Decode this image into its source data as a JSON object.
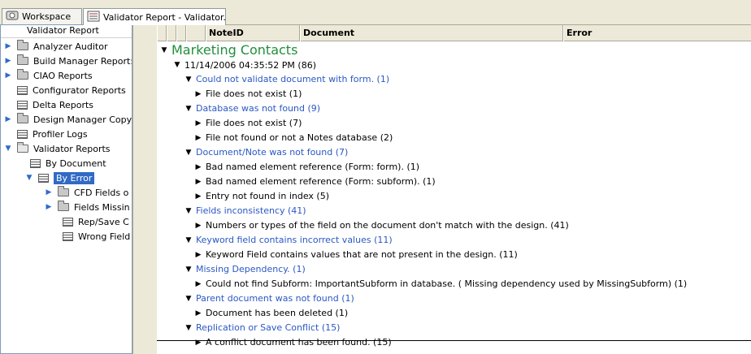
{
  "tabs": [
    {
      "label": "Workspace",
      "icon": "workspace-icon"
    },
    {
      "label": "Validator Report - Validator...",
      "icon": "validator-report-icon",
      "close": "×"
    }
  ],
  "left_panel": {
    "title": "Validator Report",
    "items": [
      {
        "label": "Analyzer Auditor",
        "type": "folder",
        "expander": "▶"
      },
      {
        "label": "Build Manager Report:",
        "type": "folder",
        "expander": "▶"
      },
      {
        "label": "CIAO Reports",
        "type": "folder",
        "expander": "▶"
      },
      {
        "label": "Configurator Reports",
        "type": "view"
      },
      {
        "label": "Delta Reports",
        "type": "view"
      },
      {
        "label": "Design Manager Copy",
        "type": "folder",
        "expander": "▶"
      },
      {
        "label": "Profiler Logs",
        "type": "view"
      },
      {
        "label": "Validator Reports",
        "type": "folder-open",
        "expander": "▼"
      },
      {
        "label": "By Document",
        "type": "view"
      },
      {
        "label": "By Error",
        "type": "view-selected",
        "expander": "▼"
      },
      {
        "label": "CFD Fields o",
        "type": "folder",
        "expander": "▶"
      },
      {
        "label": "Fields Missin",
        "type": "folder",
        "expander": "▶"
      },
      {
        "label": "Rep/Save C",
        "type": "view"
      },
      {
        "label": "Wrong Field",
        "type": "view"
      }
    ]
  },
  "columns": [
    "NoteID",
    "Document",
    "Error"
  ],
  "tree": {
    "root": "Marketing Contacts",
    "date": "11/14/2006 04:35:52 PM (86)",
    "categories": [
      {
        "label": "Could not validate document with form. (1)",
        "children": [
          "File does not exist (1)"
        ]
      },
      {
        "label": "Database was not found (9)",
        "children": [
          "File does not exist (7)",
          "File not found or not a Notes database (2)"
        ]
      },
      {
        "label": "Document/Note was not found (7)",
        "children": [
          "Bad named element reference (Form: form). (1)",
          "Bad named element reference (Form: subform). (1)",
          "Entry not found in index (5)"
        ]
      },
      {
        "label": "Fields inconsistency (41)",
        "children": [
          "Numbers or types of the field on the document don't match with the design. (41)"
        ]
      },
      {
        "label": "Keyword field contains incorrect values (11)",
        "children": [
          "Keyword Field contains values that are not present in the design. (11)"
        ]
      },
      {
        "label": "Missing Dependency. (1)",
        "children": [
          "Could not find Subform: ImportantSubform in database. ( Missing dependency used by MissingSubform) (1)"
        ]
      },
      {
        "label": "Parent document was not found (1)",
        "children": [
          "Document has been deleted (1)"
        ]
      },
      {
        "label": "Replication or Save Conflict (15)",
        "children": [
          "A conflict document has been found. (15)"
        ]
      }
    ]
  },
  "colors": {
    "category_blue": "#2a57c4",
    "root_green": "#1f8f3a",
    "selection": "#316ac5"
  }
}
